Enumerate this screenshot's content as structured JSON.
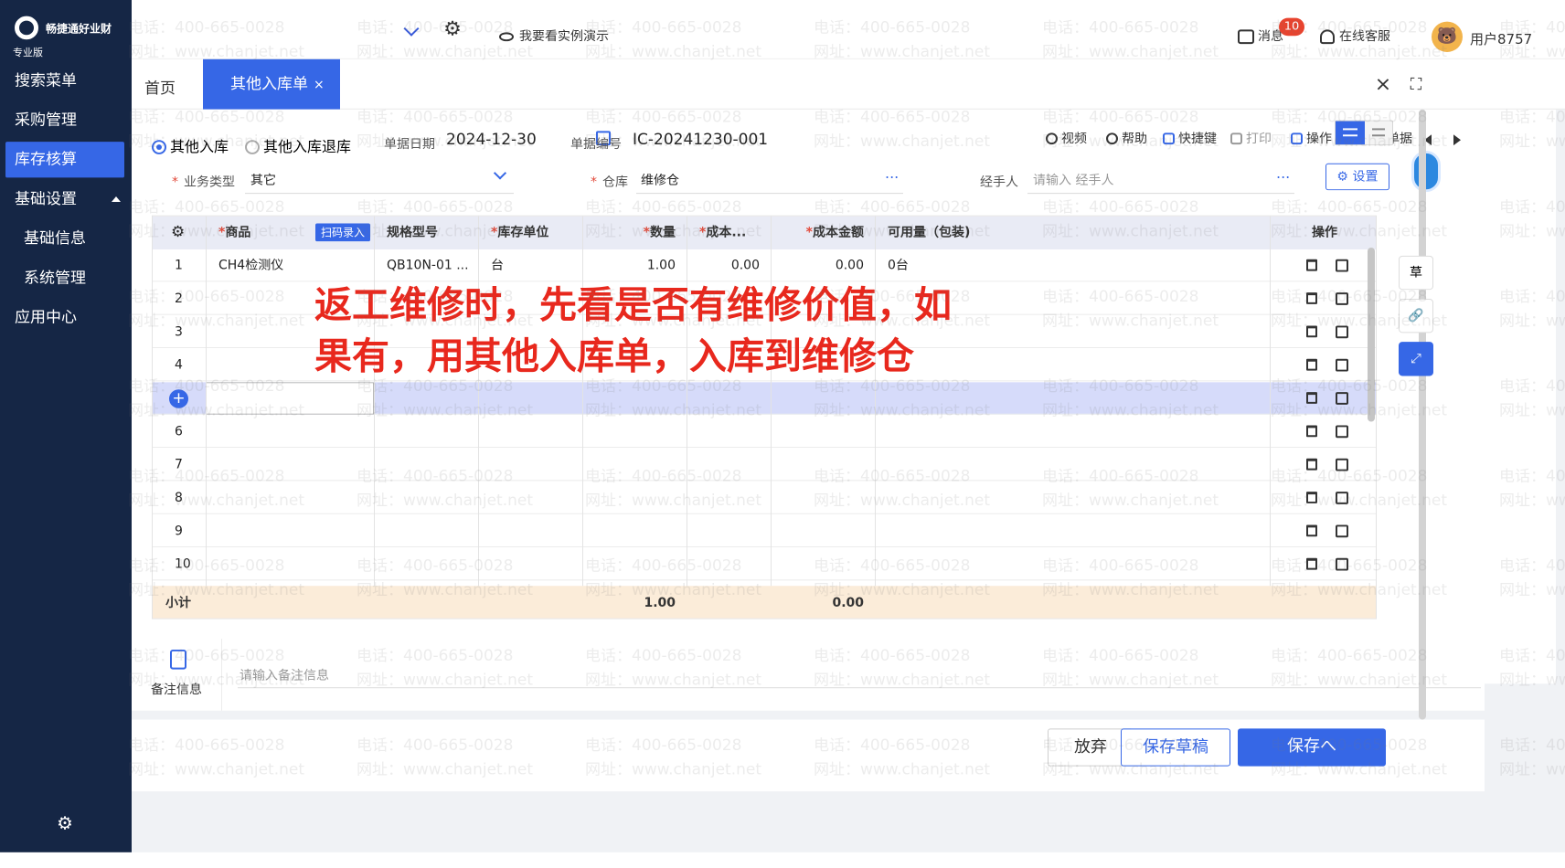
{
  "app": {
    "logo_name": "畅捷通好业财",
    "edition": "专业版",
    "top_search_value": "",
    "demo_link": "我要看实例演示",
    "messages_label": "消息",
    "messages_count": "10",
    "service_label": "在线客服",
    "username": "用户8757"
  },
  "sidebar": {
    "items": [
      {
        "label": "搜索菜单"
      },
      {
        "label": "采购管理"
      },
      {
        "label": "库存核算"
      },
      {
        "label": "基础设置"
      },
      {
        "label": "基础信息"
      },
      {
        "label": "系统管理"
      },
      {
        "label": "应用中心"
      }
    ]
  },
  "tabs": [
    {
      "label": "首页"
    },
    {
      "label": "其他入库单"
    }
  ],
  "tab_close_symbol": "×",
  "form": {
    "radio_in": "其他入库",
    "radio_return": "其他入库退库",
    "date_label": "单据日期",
    "date_value": "2024-12-30",
    "no_label": "单据编号",
    "no_value": "IC-20241230-001",
    "actions": [
      "视频",
      "帮助",
      "快捷键",
      "打印",
      "操作",
      "历史单据"
    ],
    "biz_type_label": "业务类型",
    "biz_type_value": "其它",
    "warehouse_label": "仓库",
    "warehouse_value": "维修仓",
    "handler_label": "经手人",
    "handler_placeholder": "请输入 经手人",
    "settings_label": "设置",
    "more_symbol": "···"
  },
  "table": {
    "columns": [
      "商品",
      "规格型号",
      "库存单位",
      "数量",
      "成本...",
      "成本金额",
      "可用量（包装)",
      "操作"
    ],
    "scan_tag": "扫码录入",
    "rows": [
      {
        "no": "1",
        "product": "CH4检测仪",
        "spec": "QB10N-01 ...",
        "unit": "台",
        "qty": "1.00",
        "cost": "0.00",
        "amount": "0.00",
        "avail": "0台"
      },
      {
        "no": "2",
        "product": "",
        "spec": "",
        "unit": "",
        "qty": "",
        "cost": "",
        "amount": "",
        "avail": ""
      },
      {
        "no": "3",
        "product": "",
        "spec": "",
        "unit": "",
        "qty": "",
        "cost": "",
        "amount": "",
        "avail": ""
      },
      {
        "no": "4",
        "product": "",
        "spec": "",
        "unit": "",
        "qty": "",
        "cost": "",
        "amount": "",
        "avail": ""
      },
      {
        "no": "",
        "product": "",
        "spec": "",
        "unit": "",
        "qty": "",
        "cost": "",
        "amount": "",
        "avail": ""
      },
      {
        "no": "6",
        "product": "",
        "spec": "",
        "unit": "",
        "qty": "",
        "cost": "",
        "amount": "",
        "avail": ""
      },
      {
        "no": "7",
        "product": "",
        "spec": "",
        "unit": "",
        "qty": "",
        "cost": "",
        "amount": "",
        "avail": ""
      },
      {
        "no": "8",
        "product": "",
        "spec": "",
        "unit": "",
        "qty": "",
        "cost": "",
        "amount": "",
        "avail": ""
      },
      {
        "no": "9",
        "product": "",
        "spec": "",
        "unit": "",
        "qty": "",
        "cost": "",
        "amount": "",
        "avail": ""
      },
      {
        "no": "10",
        "product": "",
        "spec": "",
        "unit": "",
        "qty": "",
        "cost": "",
        "amount": "",
        "avail": ""
      }
    ],
    "subtotal_label": "小计",
    "subtotal_qty": "1.00",
    "subtotal_amount": "0.00"
  },
  "overlay_lines": [
    "返工维修时，先看是否有维修价值，如",
    "果有，用其他入库单，入库到维修仓"
  ],
  "remarks": {
    "label": "备注信息",
    "placeholder": "请输入备注信息"
  },
  "footer": {
    "discard": "放弃",
    "save_draft": "保存草稿",
    "save": "保存へ"
  },
  "rail": {
    "draft_glyph": "草"
  },
  "watermark": {
    "phone": "电话：400-665-0028",
    "site": "网址：www.chanjet.net"
  },
  "colors": {
    "primary": "#3667e6",
    "sidebar": "#152645",
    "overlay": "#e8281d"
  }
}
